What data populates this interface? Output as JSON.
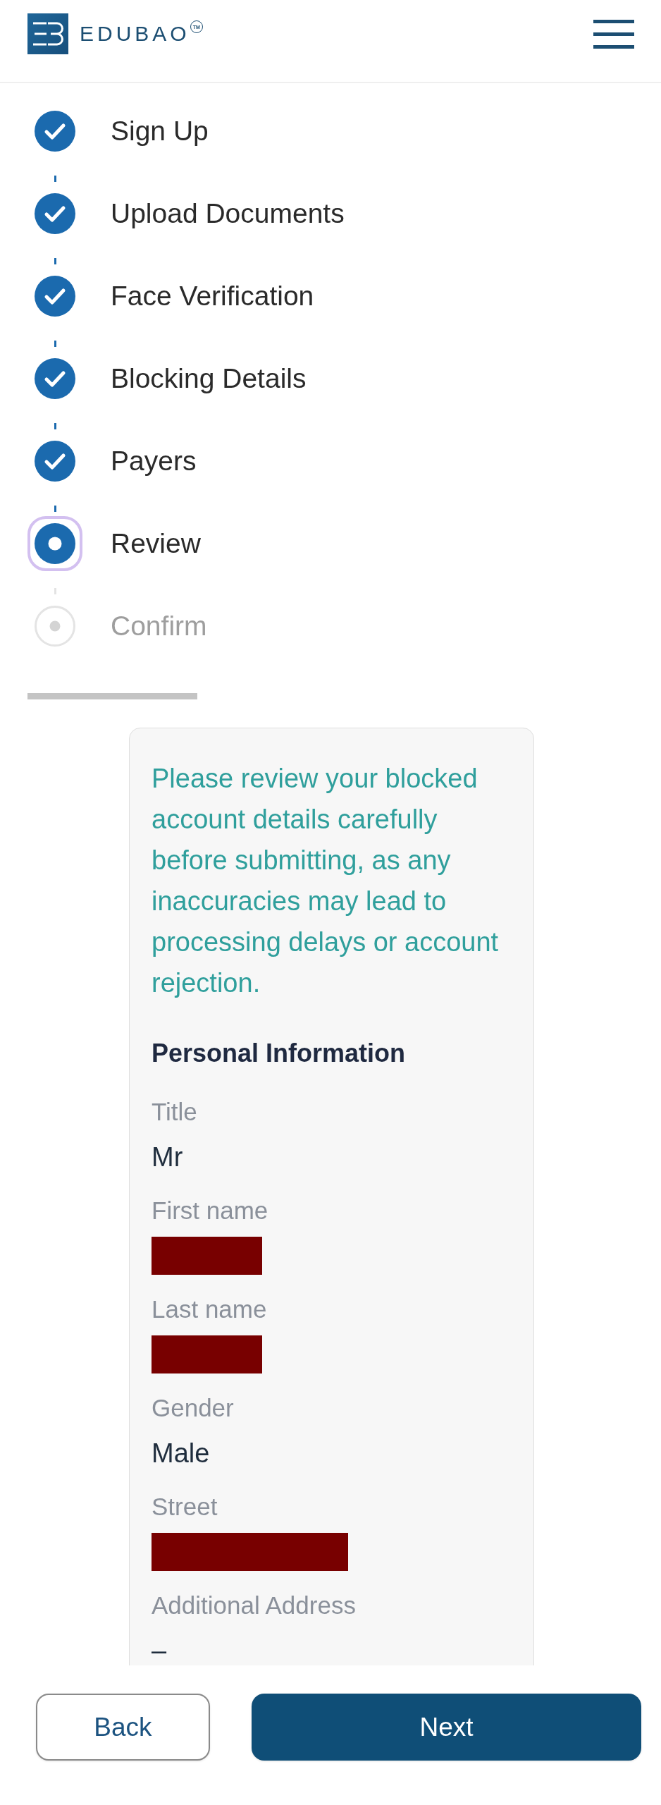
{
  "header": {
    "brand": "EDUBAO",
    "trademark": "TM"
  },
  "steps": [
    {
      "label": "Sign Up",
      "completed": true,
      "selected": false
    },
    {
      "label": "Upload Documents",
      "completed": true,
      "selected": false
    },
    {
      "label": "Face Verification",
      "completed": true,
      "selected": false
    },
    {
      "label": "Blocking Details",
      "completed": true,
      "selected": false
    },
    {
      "label": "Payers",
      "completed": true,
      "selected": false
    },
    {
      "label": "Review",
      "completed": false,
      "selected": true
    },
    {
      "label": "Confirm",
      "completed": false,
      "selected": false
    }
  ],
  "review_card": {
    "notice": "Please review your blocked account details carefully before submitting, as any inaccuracies may lead to processing delays or account rejection.",
    "section_title": "Personal Information",
    "fields": [
      {
        "label": "Title",
        "value": "Mr",
        "redacted": false
      },
      {
        "label": "First name",
        "redacted": true
      },
      {
        "label": "Last name",
        "redacted": true
      },
      {
        "label": "Gender",
        "value": "Male",
        "redacted": false
      },
      {
        "label": "Street",
        "redacted": true
      },
      {
        "label": "Additional Address",
        "value": "–",
        "redacted": false
      }
    ]
  },
  "footer": {
    "back_button": "Back",
    "next_button": "Next"
  }
}
